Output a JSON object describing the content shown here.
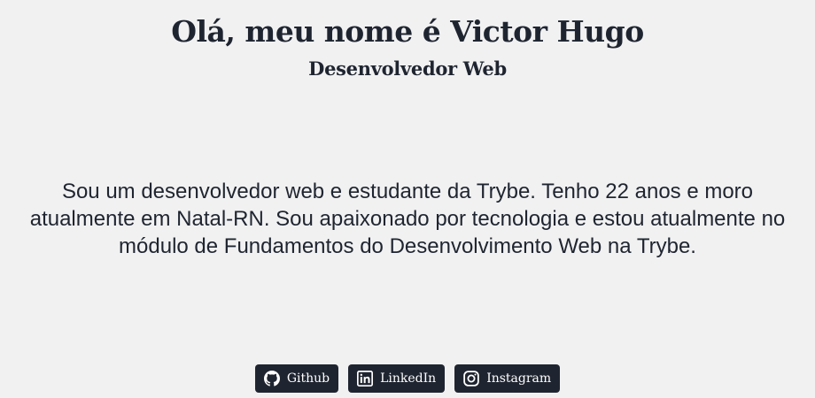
{
  "header": {
    "title": "Olá, meu nome é Victor Hugo",
    "subtitle": "Desenvolvedor Web"
  },
  "about": {
    "text": "Sou um desenvolvedor web e estudante da Trybe. Tenho 22 anos e moro atualmente em Natal-RN. Sou apaixonado por tecnologia e estou atualmente no módulo de Fundamentos do Desenvolvimento Web na Trybe."
  },
  "social": [
    {
      "label": "Github",
      "icon": "github-icon"
    },
    {
      "label": "LinkedIn",
      "icon": "linkedin-icon"
    },
    {
      "label": "Instagram",
      "icon": "instagram-icon"
    }
  ],
  "colors": {
    "background": "#f1f1f2",
    "text": "#1f2530",
    "button_bg": "#1f2530",
    "button_text": "#ffffff"
  }
}
